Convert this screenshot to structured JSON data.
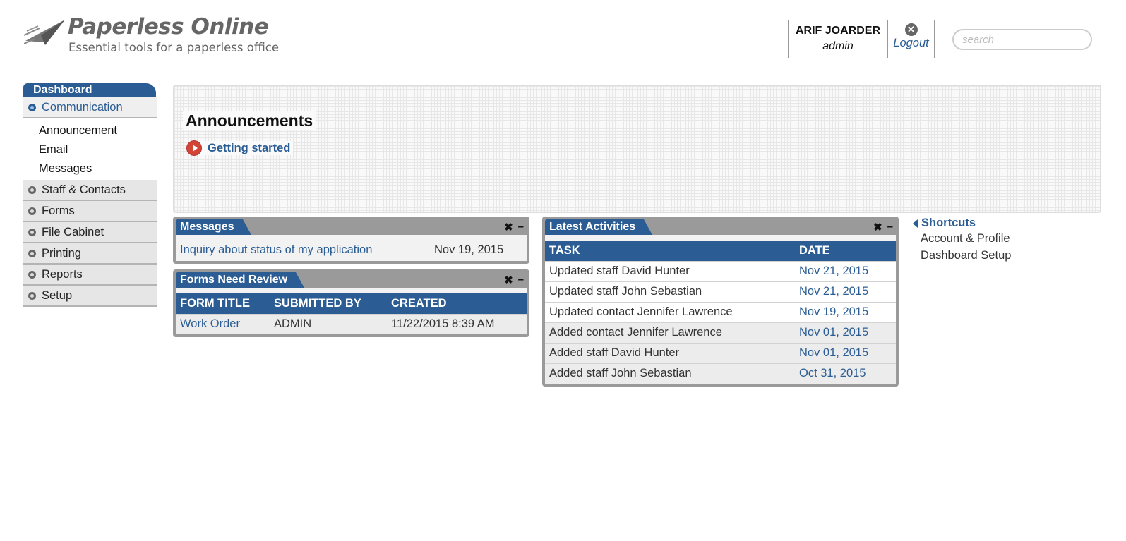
{
  "brand": {
    "name": "Paperless Online",
    "tagline": "Essential tools for a paperless office"
  },
  "user": {
    "name": "ARIF JOARDER",
    "role": "admin",
    "logout_label": "Logout"
  },
  "search": {
    "placeholder": "search"
  },
  "sidebar": {
    "tab": "Dashboard",
    "items": [
      {
        "label": "Communication",
        "active": true,
        "sub": [
          "Announcement",
          "Email",
          "Messages"
        ]
      },
      {
        "label": "Staff & Contacts"
      },
      {
        "label": "Forms"
      },
      {
        "label": "File Cabinet"
      },
      {
        "label": "Printing"
      },
      {
        "label": "Reports"
      },
      {
        "label": "Setup"
      }
    ]
  },
  "announcements": {
    "title": "Announcements",
    "link": "Getting started"
  },
  "widgets": {
    "close_glyph": "✖",
    "minimize_glyph": "–",
    "messages": {
      "title": "Messages",
      "rows": [
        {
          "subject": "Inquiry about status of my application",
          "date": "Nov 19, 2015"
        }
      ]
    },
    "forms": {
      "title": "Forms Need Review",
      "headers": [
        "FORM TITLE",
        "SUBMITTED BY",
        "CREATED"
      ],
      "rows": [
        {
          "title": "Work Order",
          "by": "ADMIN",
          "created": "11/22/2015 8:39 AM"
        }
      ]
    },
    "activities": {
      "title": "Latest Activities",
      "headers": [
        "TASK",
        "DATE"
      ],
      "rows": [
        {
          "task": "Updated staff David Hunter",
          "date": "Nov 21, 2015"
        },
        {
          "task": "Updated staff John Sebastian",
          "date": "Nov 21, 2015"
        },
        {
          "task": "Updated contact Jennifer Lawrence",
          "date": "Nov 19, 2015"
        },
        {
          "task": "Added contact Jennifer Lawrence",
          "date": "Nov 01, 2015"
        },
        {
          "task": "Added staff David Hunter",
          "date": "Nov 01, 2015"
        },
        {
          "task": "Added staff John Sebastian",
          "date": "Oct 31, 2015"
        }
      ]
    }
  },
  "shortcuts": {
    "title": "Shortcuts",
    "items": [
      "Account & Profile",
      "Dashboard Setup"
    ]
  },
  "colors": {
    "accent": "#2b5d94",
    "play_icon": "#d04535",
    "widget_frame": "#9a9a9a"
  }
}
